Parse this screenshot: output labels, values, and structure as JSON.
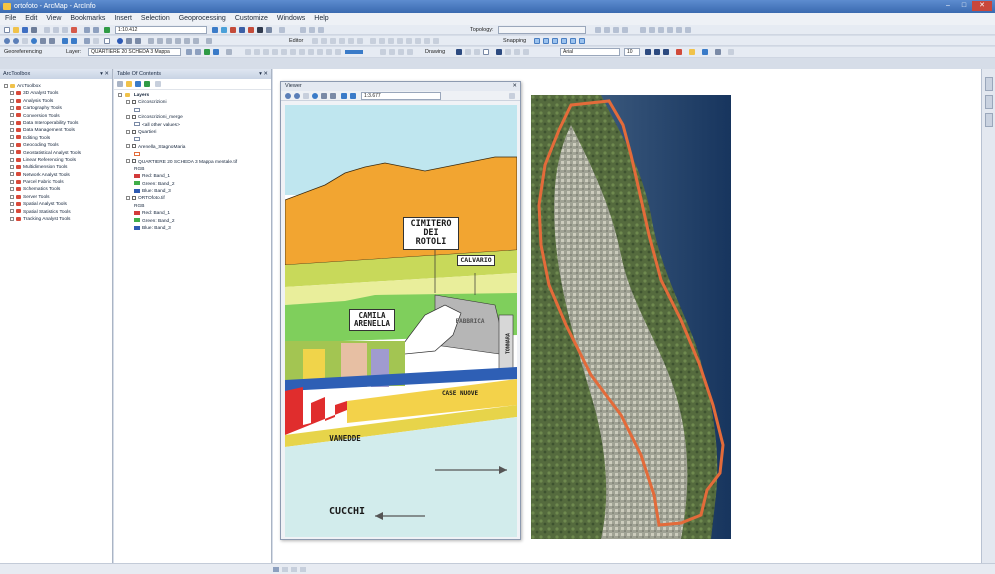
{
  "window": {
    "title": "ortofoto - ArcMap - ArcInfo"
  },
  "menu": [
    "File",
    "Edit",
    "View",
    "Bookmarks",
    "Insert",
    "Selection",
    "Geoprocessing",
    "Customize",
    "Windows",
    "Help"
  ],
  "toolbars": {
    "scale": "1:10.412",
    "topology_label": "Topology:",
    "editor_label": "Editor",
    "snapping_label": "Snapping",
    "georef_label": "Georeferencing",
    "layer_label": "Layer:",
    "layer_value": "QUARTIERE 20 SCHEDA 3 Mappa",
    "drawing_label": "Drawing",
    "font_value": "Arial",
    "font_size": "10"
  },
  "toolbox": {
    "header": "ArcToolbox",
    "items": [
      "ArcToolbox",
      "3D Analyst Tools",
      "Analysis Tools",
      "Cartography Tools",
      "Conversion Tools",
      "Data Interoperability Tools",
      "Data Management Tools",
      "Editing Tools",
      "Geocoding Tools",
      "Geostatistical Analyst Tools",
      "Linear Referencing Tools",
      "Multidimension Tools",
      "Network Analyst Tools",
      "Parcel Fabric Tools",
      "Schematics Tools",
      "Server Tools",
      "Spatial Analyst Tools",
      "Spatial Statistics Tools",
      "Tracking Analyst Tools"
    ]
  },
  "toc": {
    "header": "Table Of Contents",
    "layers_root": "Layers",
    "rows": [
      {
        "label": "Circoscrizioni",
        "indent": 1,
        "type": "layer"
      },
      {
        "label": "",
        "indent": 2,
        "type": "symbol"
      },
      {
        "label": "Circoscrizioni_merge",
        "indent": 1,
        "type": "layer"
      },
      {
        "label": "<all other values>",
        "indent": 2,
        "type": "symbol"
      },
      {
        "label": "Quartieri",
        "indent": 1,
        "type": "layer"
      },
      {
        "label": "",
        "indent": 2,
        "type": "symbol"
      },
      {
        "label": "Arenella_StagnoMaria",
        "indent": 1,
        "type": "layer"
      },
      {
        "label": "",
        "indent": 2,
        "type": "symbol-orange"
      },
      {
        "label": "QUARTIERE 20 SCHEDA 3 Mappa mentale.tif",
        "indent": 1,
        "type": "layer"
      },
      {
        "label": "RGB",
        "indent": 2,
        "type": "text"
      },
      {
        "label": "Red: Band_1",
        "indent": 2,
        "type": "red"
      },
      {
        "label": "Green: Band_2",
        "indent": 2,
        "type": "green"
      },
      {
        "label": "Blue: Band_3",
        "indent": 2,
        "type": "blue"
      },
      {
        "label": "ORTOfoto.tif",
        "indent": 1,
        "type": "layer"
      },
      {
        "label": "RGB",
        "indent": 2,
        "type": "text"
      },
      {
        "label": "Red: Band_1",
        "indent": 2,
        "type": "red"
      },
      {
        "label": "Green: Band_2",
        "indent": 2,
        "type": "green"
      },
      {
        "label": "Blue: Band_3",
        "indent": 2,
        "type": "blue"
      }
    ]
  },
  "viewer": {
    "title": "Viewer",
    "scale": "1:3.677"
  },
  "sketch": {
    "labels": {
      "cimitero": "CIMITERO DEI ROTOLI",
      "calvario": "CALVARIO",
      "camila": "CAMILA ARENELLA",
      "fabbrica": "FABBRICA",
      "tonnara": "TONNARA",
      "case_nuove": "CASE NUOVE",
      "vanedde": "VANEDDE",
      "cucchi": "CUCCHI"
    },
    "colors": {
      "sky": "#bfe6ef",
      "mountain": "#f2a531",
      "band1": "#c8d95a",
      "band2": "#e9ee9b",
      "coast": "#7fcf5c",
      "buildings": "#e02d2d",
      "sea": "#d2ecec"
    }
  },
  "status": {
    "coords": ""
  }
}
